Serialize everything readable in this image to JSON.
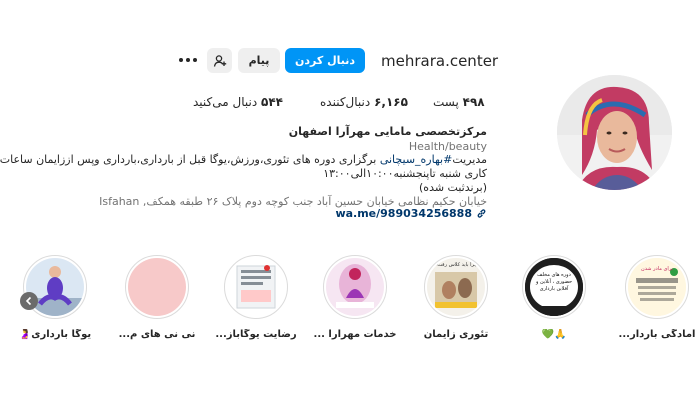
{
  "header": {
    "username": "mehrara.center",
    "follow_label": "دنبال کردن",
    "message_label": "پیام"
  },
  "stats": {
    "posts_count": "۴۹۸",
    "posts_label": "پست",
    "followers_count": "۶,۱۶۵",
    "followers_label": "دنبال‌کننده",
    "following_count": "۵۴۴",
    "following_label": "دنبال می‌کنید"
  },
  "bio": {
    "name": "مرکزتخصصی مامایی مهرآرا اصفهان",
    "category": "Health/beauty",
    "line1_prefix": "مدیریت",
    "line1_hashtag": "#بهاره_سیچانی",
    "line1_suffix": " برگزاری دوره های تئوری،ورزش،یوگا قبل از بارداری،بارداری وپس اززایمان ساعات",
    "line2": "کاری شنبه تاپنجشنبه۱۰:۰۰الی۱۳:۰۰",
    "line3": "(برندثبت شده)",
    "address": "خیابان حکیم نظامی خیابان حسین آباد جنب کوچه دوم پلاک ۲۶ طبقه همکف, Isfahan",
    "website": "wa.me/989034256888"
  },
  "highlights": [
    {
      "label": "آمادگی باردار..."
    },
    {
      "label": "🙏💚"
    },
    {
      "label": "تئوری زایمان"
    },
    {
      "label": "خدمات مهرآرا ..."
    },
    {
      "label": "رضایت یوگاباز..."
    },
    {
      "label": "نی نی های م..."
    },
    {
      "label": "یوگا بارداری🤰"
    }
  ],
  "highlight_texts": {
    "h1_title": "برای مادر شدن",
    "h2_text": "دوره های مخلف حضوری ، آنلاین و آفلاین بارداری",
    "h3_text": "چرا باید کلاس رفت؟"
  },
  "colors": {
    "accent": "#0095f6",
    "link": "#00376b",
    "muted": "#737373"
  }
}
